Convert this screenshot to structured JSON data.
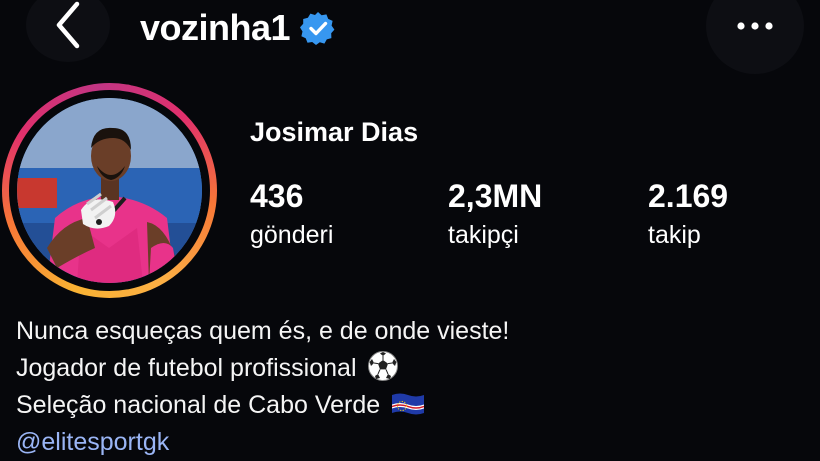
{
  "header": {
    "username": "vozinha1",
    "verified": true,
    "back_icon": "chevron-left-icon",
    "more_icon": "more-horizontal-icon"
  },
  "profile": {
    "display_name": "Josimar Dias",
    "stats": [
      {
        "value": "436",
        "label": "gönderi"
      },
      {
        "value": "2,3MN",
        "label": "takipçi"
      },
      {
        "value": "2.169",
        "label": "takip"
      }
    ]
  },
  "bio": {
    "line1": "Nunca esqueças quem és, e de onde vieste!",
    "line2": "Jogador de futebol profissional",
    "line3": "Seleção nacional de Cabo Verde",
    "link": "@elitesportgk"
  },
  "colors": {
    "background": "#06070b",
    "verified_badge": "#3797f0",
    "link": "#9ab5f5",
    "story_ring_start": "#f9b233",
    "story_ring_end": "#c13584"
  }
}
